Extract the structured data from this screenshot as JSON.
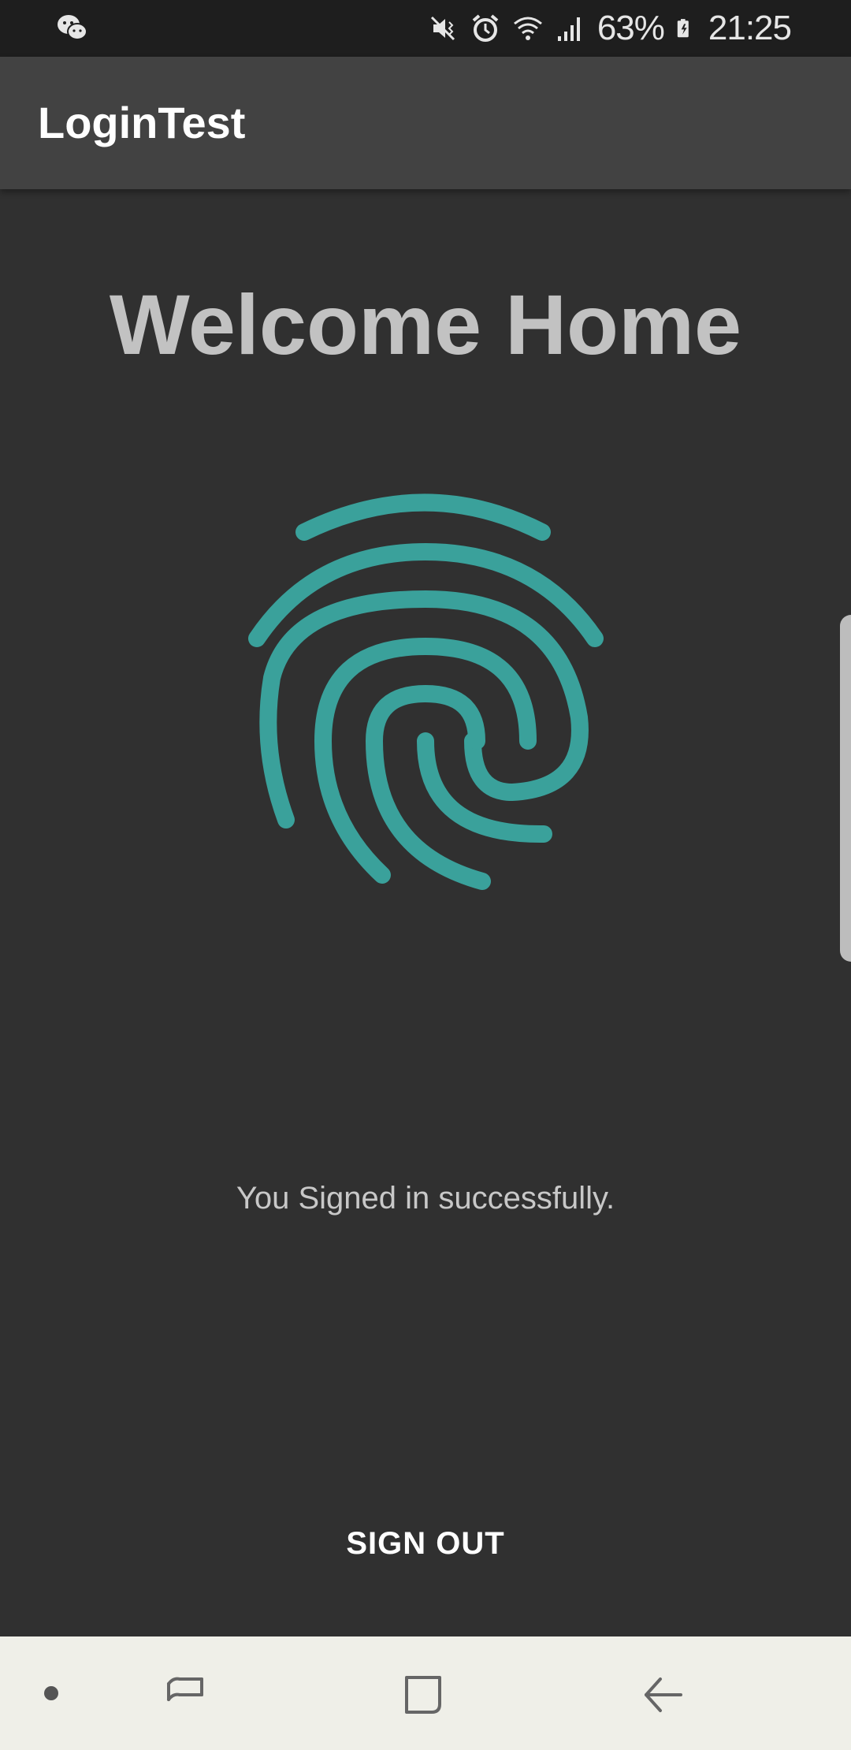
{
  "status_bar": {
    "battery_text": "63%",
    "time": "21:25",
    "icons": [
      "wechat-icon",
      "mute-icon",
      "alarm-icon",
      "wifi-icon",
      "signal-icon",
      "battery-charging-icon"
    ]
  },
  "app_bar": {
    "title": "LoginTest"
  },
  "main": {
    "heading": "Welcome Home",
    "fingerprint_icon": "fingerprint-icon",
    "fingerprint_color": "#3aa19b",
    "message": "You Signed in successfully.",
    "sign_out_label": "SIGN OUT"
  },
  "nav_bar": {
    "icons": [
      "dot-indicator",
      "recent-apps-icon",
      "home-icon",
      "back-icon"
    ]
  },
  "colors": {
    "background": "#303030",
    "app_bar": "#424242",
    "status_bar": "#1e1e1e",
    "nav_bar": "#efefe8",
    "accent": "#3aa19b"
  }
}
